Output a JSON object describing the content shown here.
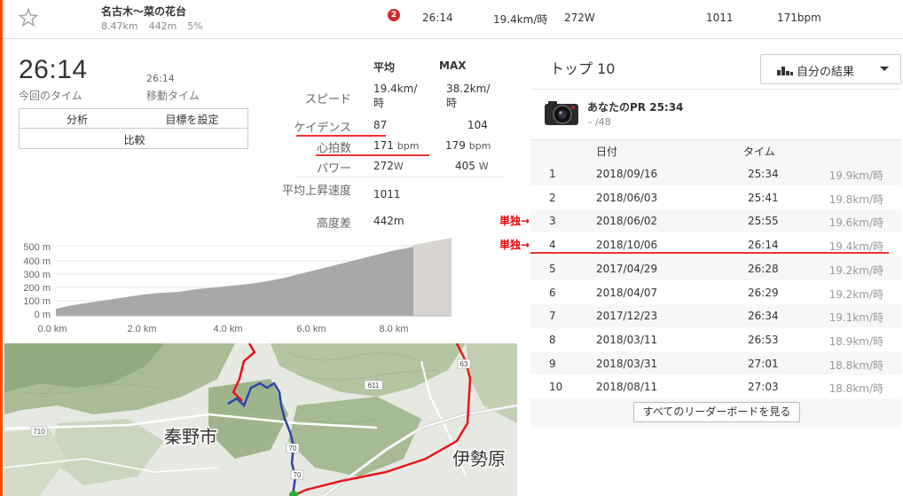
{
  "segment": {
    "name": "名古木～菜の花台",
    "distance": "8.47km",
    "elevation": "442m",
    "grade": "5%",
    "rank": "2",
    "time": "26:14",
    "speed": "19.4km/時",
    "power": "272W",
    "value": "1011",
    "heartrate": "171bpm"
  },
  "summary": {
    "elapsed_time": "26:14",
    "elapsed_label": "今回のタイム",
    "moving_time": "26:14",
    "moving_label": "移動タイム"
  },
  "buttons": {
    "analysis": "分析",
    "set_goal": "目標を設定",
    "compare": "比較"
  },
  "stats": {
    "header_avg": "平均",
    "header_max": "MAX",
    "speed_label": "スピード",
    "speed_avg_1": "19.4km/",
    "speed_avg_2": "時",
    "speed_max_1": "38.2km/",
    "speed_max_2": "時",
    "cadence_label": "ケイデンス",
    "cadence_avg": "87",
    "cadence_max": "104",
    "hr_label": "心拍数",
    "hr_avg": "171",
    "hr_max": "179",
    "hr_unit": "bpm",
    "power_label": "パワー",
    "power_avg": "272",
    "power_max": "405",
    "power_unit": "W",
    "climb_label": "平均上昇速度",
    "climb_value": "1011",
    "elev_label": "高度差",
    "elev_value": "442m"
  },
  "elevation_chart": {
    "y_ticks": [
      "500 m",
      "400 m",
      "300 m",
      "200 m",
      "100 m",
      "0 m"
    ],
    "x_ticks": [
      "0.0 km",
      "2.0 km",
      "4.0 km",
      "6.0 km",
      "8.0 km"
    ]
  },
  "map": {
    "city_1": "秦野市",
    "city_2": "伊勢原",
    "road_1": "710",
    "road_2": "611",
    "road_3": "63",
    "road_4": "70",
    "road_5": "70"
  },
  "leaderboard": {
    "title": "トップ 10",
    "filter_label": "自分の結果",
    "pr_title": "あなたのPR 25:34",
    "pr_sub": "– /48",
    "col_date": "日付",
    "col_time": "タイム",
    "rows": [
      {
        "rank": "1",
        "date": "2018/09/16",
        "time": "25:34",
        "speed": "19.9km/時"
      },
      {
        "rank": "2",
        "date": "2018/06/03",
        "time": "25:41",
        "speed": "19.8km/時"
      },
      {
        "rank": "3",
        "date": "2018/06/02",
        "time": "25:55",
        "speed": "19.6km/時"
      },
      {
        "rank": "4",
        "date": "2018/10/06",
        "time": "26:14",
        "speed": "19.4km/時"
      },
      {
        "rank": "5",
        "date": "2017/04/29",
        "time": "26:28",
        "speed": "19.2km/時"
      },
      {
        "rank": "6",
        "date": "2018/04/07",
        "time": "26:29",
        "speed": "19.2km/時"
      },
      {
        "rank": "7",
        "date": "2017/12/23",
        "time": "26:34",
        "speed": "19.1km/時"
      },
      {
        "rank": "8",
        "date": "2018/03/11",
        "time": "26:53",
        "speed": "18.9km/時"
      },
      {
        "rank": "9",
        "date": "2018/03/31",
        "time": "27:01",
        "speed": "18.8km/時"
      },
      {
        "rank": "10",
        "date": "2018/08/11",
        "time": "27:03",
        "speed": "18.8km/時"
      }
    ],
    "view_all": "すべてのリーダーボードを見る"
  },
  "annotations": {
    "solo_1": "単独→",
    "solo_2": "単独→"
  },
  "colors": {
    "accent": "#fc4c02",
    "annotation_red": "#ee2222",
    "route_red": "#e8161b",
    "route_blue": "#2b47a8"
  }
}
